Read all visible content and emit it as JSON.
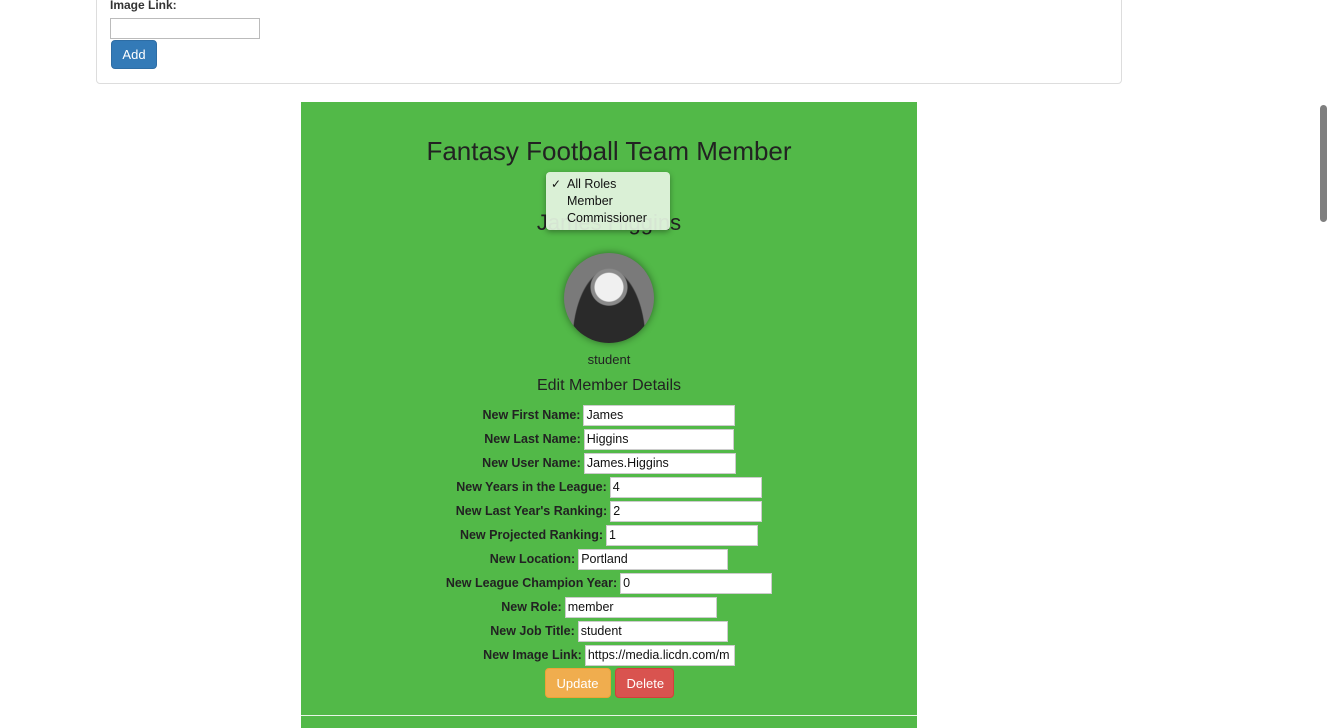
{
  "top_form": {
    "image_link_label": "Image Link:",
    "image_link_value": "",
    "add_button_label": "Add"
  },
  "card": {
    "title": "Fantasy Football Team Member",
    "member_name": "James Higgins",
    "job_title_caption": "student",
    "edit_heading": "Edit Member Details"
  },
  "role_dropdown": {
    "options": [
      "All Roles",
      "Member",
      "Commissioner"
    ],
    "selected": "All Roles",
    "check_mark": "✓"
  },
  "form": {
    "fields": [
      {
        "label": "New First Name:",
        "value": "James"
      },
      {
        "label": "New Last Name:",
        "value": "Higgins"
      },
      {
        "label": "New User Name:",
        "value": "James.Higgins"
      },
      {
        "label": "New Years in the League:",
        "value": "4"
      },
      {
        "label": "New Last Year's Ranking:",
        "value": "2"
      },
      {
        "label": "New Projected Ranking:",
        "value": "1"
      },
      {
        "label": "New Location:",
        "value": "Portland"
      },
      {
        "label": "New League Champion Year:",
        "value": "0"
      },
      {
        "label": "New Role:",
        "value": "member"
      },
      {
        "label": "New Job Title:",
        "value": "student"
      },
      {
        "label": "New Image Link:",
        "value": "https://media.licdn.com/m"
      }
    ],
    "update_label": "Update",
    "delete_label": "Delete"
  },
  "colors": {
    "card_background": "#52b948",
    "primary_button": "#337ab7",
    "warning_button": "#f0ad4e",
    "danger_button": "#d9534f"
  }
}
